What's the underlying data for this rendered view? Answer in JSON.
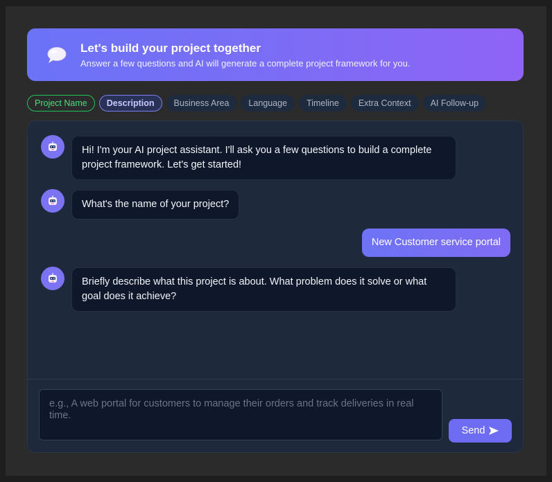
{
  "header": {
    "title": "Let's build your project together",
    "subtitle": "Answer a few questions and AI will generate a complete project framework for you.",
    "icon": "speech-bubble-icon"
  },
  "steps": [
    {
      "label": "Project Name",
      "state": "done"
    },
    {
      "label": "Description",
      "state": "active"
    },
    {
      "label": "Business Area",
      "state": "pending"
    },
    {
      "label": "Language",
      "state": "pending"
    },
    {
      "label": "Timeline",
      "state": "pending"
    },
    {
      "label": "Extra Context",
      "state": "pending"
    },
    {
      "label": "AI Follow-up",
      "state": "pending"
    }
  ],
  "messages": [
    {
      "sender": "assistant",
      "text": "Hi! I'm your AI project assistant. I'll ask you a few questions to build a complete project framework. Let's get started!"
    },
    {
      "sender": "assistant",
      "text": "What's the name of your project?"
    },
    {
      "sender": "user",
      "text": "New Customer service portal"
    },
    {
      "sender": "assistant",
      "text": "Briefly describe what this project is about. What problem does it solve or what goal does it achieve?"
    }
  ],
  "input": {
    "value": "",
    "placeholder": "e.g., A web portal for customers to manage their orders and track deliveries in real time."
  },
  "send_button": {
    "label": "Send",
    "icon": "send-arrow-icon"
  },
  "colors": {
    "accent": "#6d6cf3",
    "header_gradient_start": "#6b73f7",
    "header_gradient_end": "#8f63f6",
    "done": "#22c55e",
    "panel": "#1e293b",
    "bubble": "#0f172a"
  }
}
